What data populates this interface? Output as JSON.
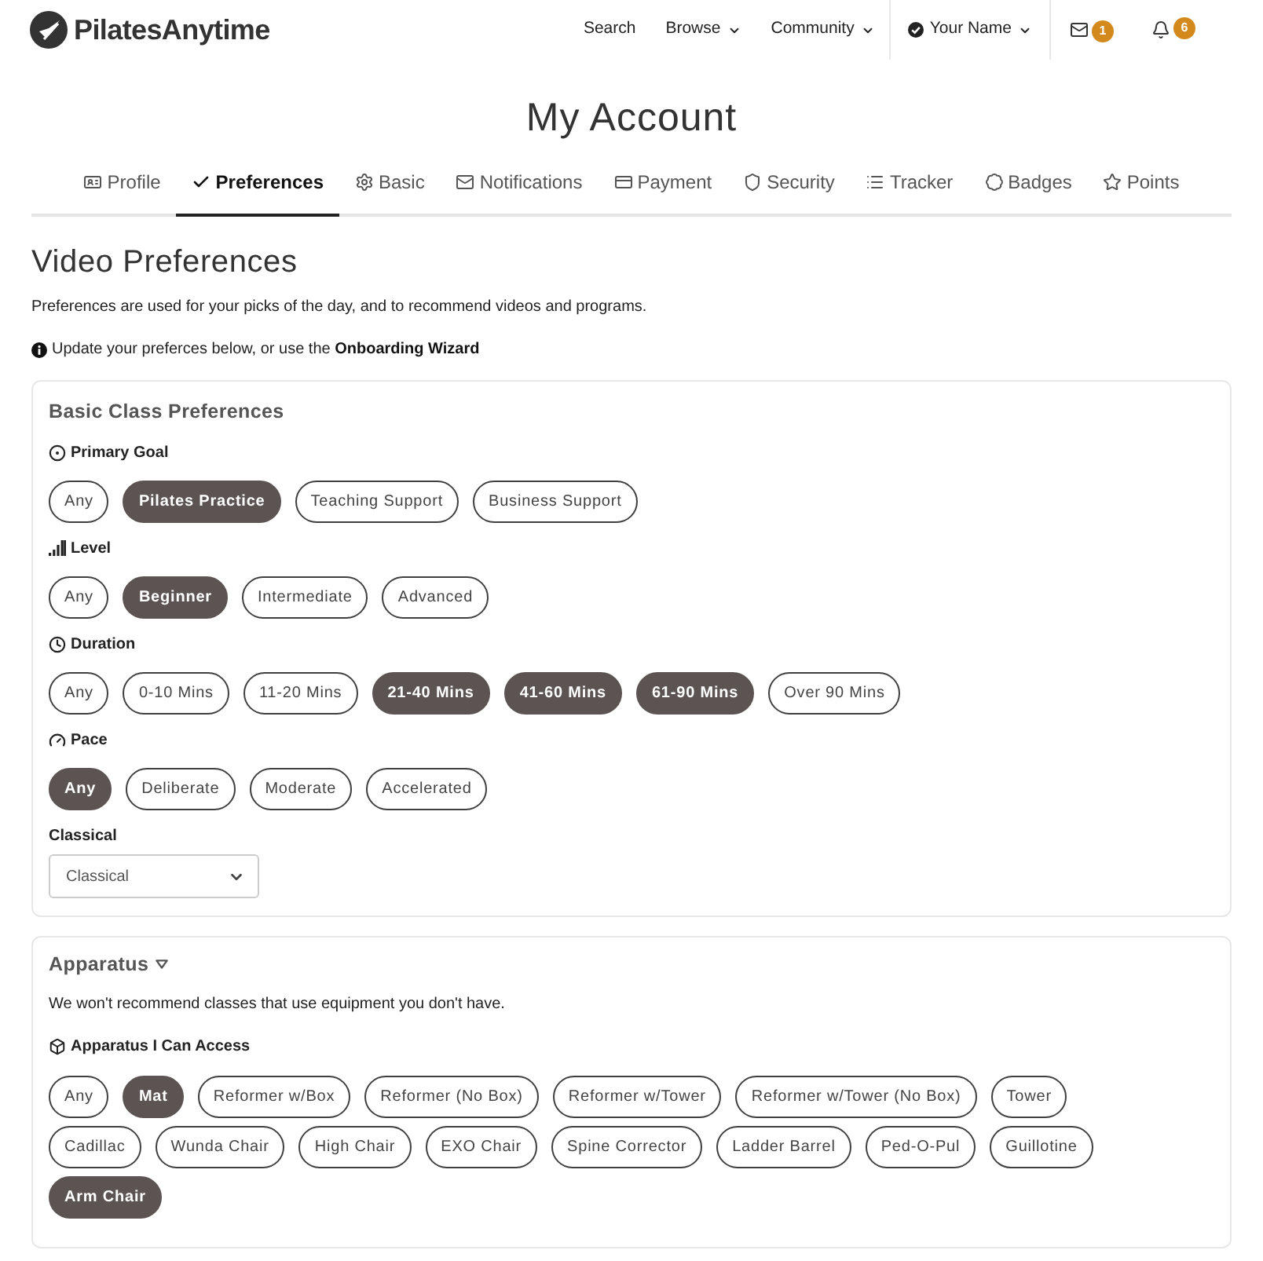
{
  "header": {
    "logo": "PilatesAnytime",
    "nav": [
      {
        "label": "Search",
        "dropdown": false
      },
      {
        "label": "Browse",
        "dropdown": true
      },
      {
        "label": "Community",
        "dropdown": true
      }
    ],
    "user": {
      "name": "Your Name"
    },
    "alerts": [
      {
        "count": "1"
      },
      {
        "count": "6"
      }
    ]
  },
  "page_title": "My Account",
  "tabs": [
    {
      "label": "Profile",
      "selected": false
    },
    {
      "label": "Preferences",
      "selected": true
    },
    {
      "label": "Basic",
      "selected": false
    },
    {
      "label": "Notifications",
      "selected": false
    },
    {
      "label": "Payment",
      "selected": false
    },
    {
      "label": "Security",
      "selected": false
    },
    {
      "label": "Tracker",
      "selected": false
    },
    {
      "label": "Badges",
      "selected": false
    },
    {
      "label": "Points",
      "selected": false
    }
  ],
  "video_preferences": {
    "title": "Video Preferences",
    "intro": "Preferences are used for your picks of the day, and to recommend videos and programs.",
    "note": {
      "text": "Update your preferces below, or use the",
      "link": "Onboarding Wizard"
    }
  },
  "basic_class_preferences": {
    "title": "Basic Class Preferences",
    "groups": [
      {
        "label": "Primary Goal",
        "options": [
          {
            "label": "Any",
            "selected": false
          },
          {
            "label": "Pilates Practice",
            "selected": true
          },
          {
            "label": "Teaching Support",
            "selected": false
          },
          {
            "label": "Business Support",
            "selected": false
          }
        ]
      },
      {
        "label": "Level",
        "options": [
          {
            "label": "Any",
            "selected": false
          },
          {
            "label": "Beginner",
            "selected": true
          },
          {
            "label": "Intermediate",
            "selected": false
          },
          {
            "label": "Advanced",
            "selected": false
          }
        ]
      },
      {
        "label": "Duration",
        "options": [
          {
            "label": "Any",
            "selected": false
          },
          {
            "label": "0-10 Mins",
            "selected": false
          },
          {
            "label": "11-20 Mins",
            "selected": false
          },
          {
            "label": "21-40 Mins",
            "selected": true
          },
          {
            "label": "41-60 Mins",
            "selected": true
          },
          {
            "label": "61-90 Mins",
            "selected": true
          },
          {
            "label": "Over 90 Mins",
            "selected": false
          }
        ]
      },
      {
        "label": "Pace",
        "options": [
          {
            "label": "Any",
            "selected": true
          },
          {
            "label": "Deliberate",
            "selected": false
          },
          {
            "label": "Moderate",
            "selected": false
          },
          {
            "label": "Accelerated",
            "selected": false
          }
        ]
      }
    ],
    "classical": {
      "label": "Classical",
      "value": "Classical"
    }
  },
  "apparatus": {
    "title": "Apparatus",
    "description": "We won't recommend classes that use equipment you don't have.",
    "group": {
      "label": "Apparatus I Can Access",
      "options": [
        {
          "label": "Any",
          "selected": false
        },
        {
          "label": "Mat",
          "selected": true
        },
        {
          "label": "Reformer w/Box",
          "selected": false
        },
        {
          "label": "Reformer (No Box)",
          "selected": false
        },
        {
          "label": "Reformer w/Tower",
          "selected": false
        },
        {
          "label": "Reformer w/Tower (No Box)",
          "selected": false
        },
        {
          "label": "Tower",
          "selected": false
        },
        {
          "label": "Cadillac",
          "selected": false
        },
        {
          "label": "Wunda Chair",
          "selected": false
        },
        {
          "label": "High Chair",
          "selected": false
        },
        {
          "label": "EXO Chair",
          "selected": false
        },
        {
          "label": "Spine Corrector",
          "selected": false
        },
        {
          "label": "Ladder Barrel",
          "selected": false
        },
        {
          "label": "Ped-O-Pul",
          "selected": false
        },
        {
          "label": "Guillotine",
          "selected": false
        },
        {
          "label": "Arm Chair",
          "selected": true
        }
      ]
    }
  }
}
